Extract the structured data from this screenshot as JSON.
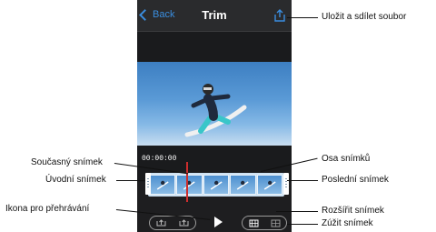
{
  "navbar": {
    "back_label": "Back",
    "title": "Trim",
    "share_icon": "share-icon"
  },
  "timeline": {
    "timecode": "00:00:00",
    "frames": 5
  },
  "callouts": {
    "share": "Uložit a sdílet soubor",
    "current_frame": "Současný snímek",
    "first_frame": "Úvodní snímek",
    "play": "Ikona pro přehrávání",
    "frame_axis": "Osa snímků",
    "last_frame": "Poslední snímek",
    "expand_frame": "Rozšířit snímek",
    "shrink_frame": "Zúžit snímek"
  }
}
